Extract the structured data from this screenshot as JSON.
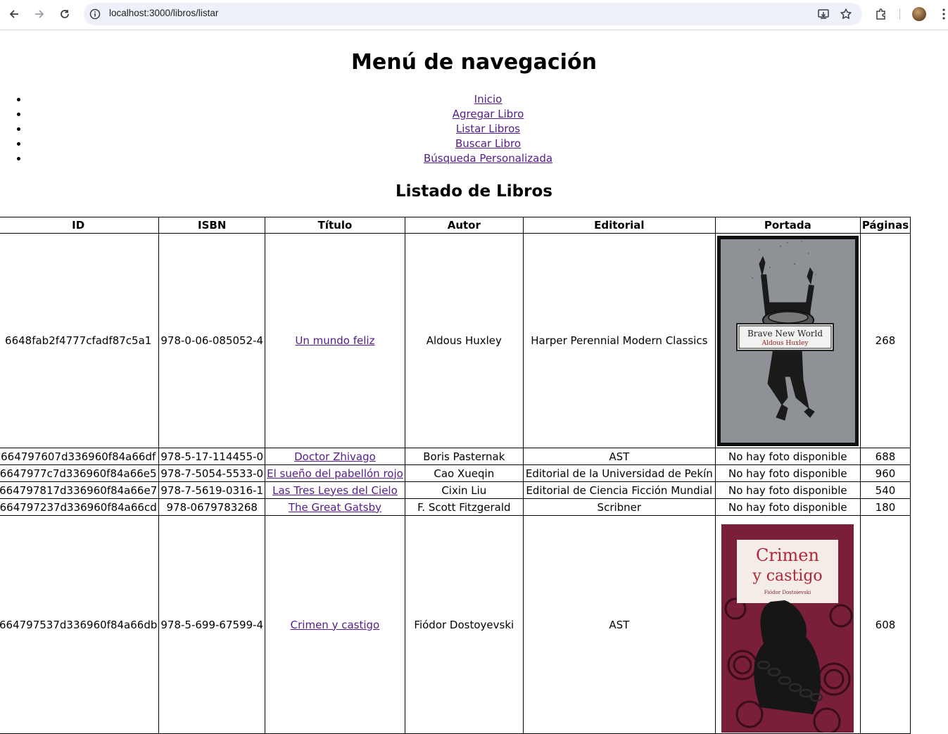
{
  "browser": {
    "url": "localhost:3000/libros/listar"
  },
  "nav": {
    "title": "Menú de navegación",
    "items": [
      {
        "label": "Inicio"
      },
      {
        "label": "Agregar Libro"
      },
      {
        "label": "Listar Libros"
      },
      {
        "label": "Buscar Libro"
      },
      {
        "label": "Búsqueda Personalizada"
      }
    ]
  },
  "list": {
    "title": "Listado de Libros",
    "headers": [
      "ID",
      "ISBN",
      "Título",
      "Autor",
      "Editorial",
      "Portada",
      "Páginas"
    ],
    "rows": [
      {
        "id": "6648fab2f4777cfadf87c5a1",
        "isbn": "978-0-06-085052-4",
        "titulo": "Un mundo feliz",
        "autor": "Aldous Huxley",
        "editorial": "Harper Perennial Modern Classics",
        "portada": {
          "title": "Brave New World",
          "author": "Aldous Huxley"
        },
        "paginas": "268"
      },
      {
        "id": "664797607d336960f84a66df",
        "isbn": "978-5-17-114455-0",
        "titulo": "Doctor Zhivago",
        "autor": "Boris Pasternak",
        "editorial": "AST",
        "portada_text": "No hay foto disponible",
        "paginas": "688"
      },
      {
        "id": "6647977c7d336960f84a66e5",
        "isbn": "978-7-5054-5533-0",
        "titulo": "El sueño del pabellón rojo",
        "autor": "Cao Xueqin",
        "editorial": "Editorial de la Universidad de Pekín",
        "portada_text": "No hay foto disponible",
        "paginas": "960"
      },
      {
        "id": "664797817d336960f84a66e7",
        "isbn": "978-7-5619-0316-1",
        "titulo": "Las Tres Leyes del Cielo",
        "autor": "Cixin Liu",
        "editorial": "Editorial de Ciencia Ficción Mundial",
        "portada_text": "No hay foto disponible",
        "paginas": "540"
      },
      {
        "id": "664797237d336960f84a66cd",
        "isbn": "978-0679783268",
        "titulo": "The Great Gatsby",
        "autor": "F. Scott Fitzgerald",
        "editorial": "Scribner",
        "portada_text": "No hay foto disponible",
        "paginas": "180"
      },
      {
        "id": "664797537d336960f84a66db",
        "isbn": "978-5-699-67599-4",
        "titulo": "Crimen y castigo",
        "autor": "Fiódor Dostoyevski",
        "editorial": "AST",
        "portada": {
          "title_line1": "Crimen",
          "title_line2": "y castigo",
          "author": "Fiódor Dostoievski"
        },
        "paginas": "608"
      }
    ]
  }
}
